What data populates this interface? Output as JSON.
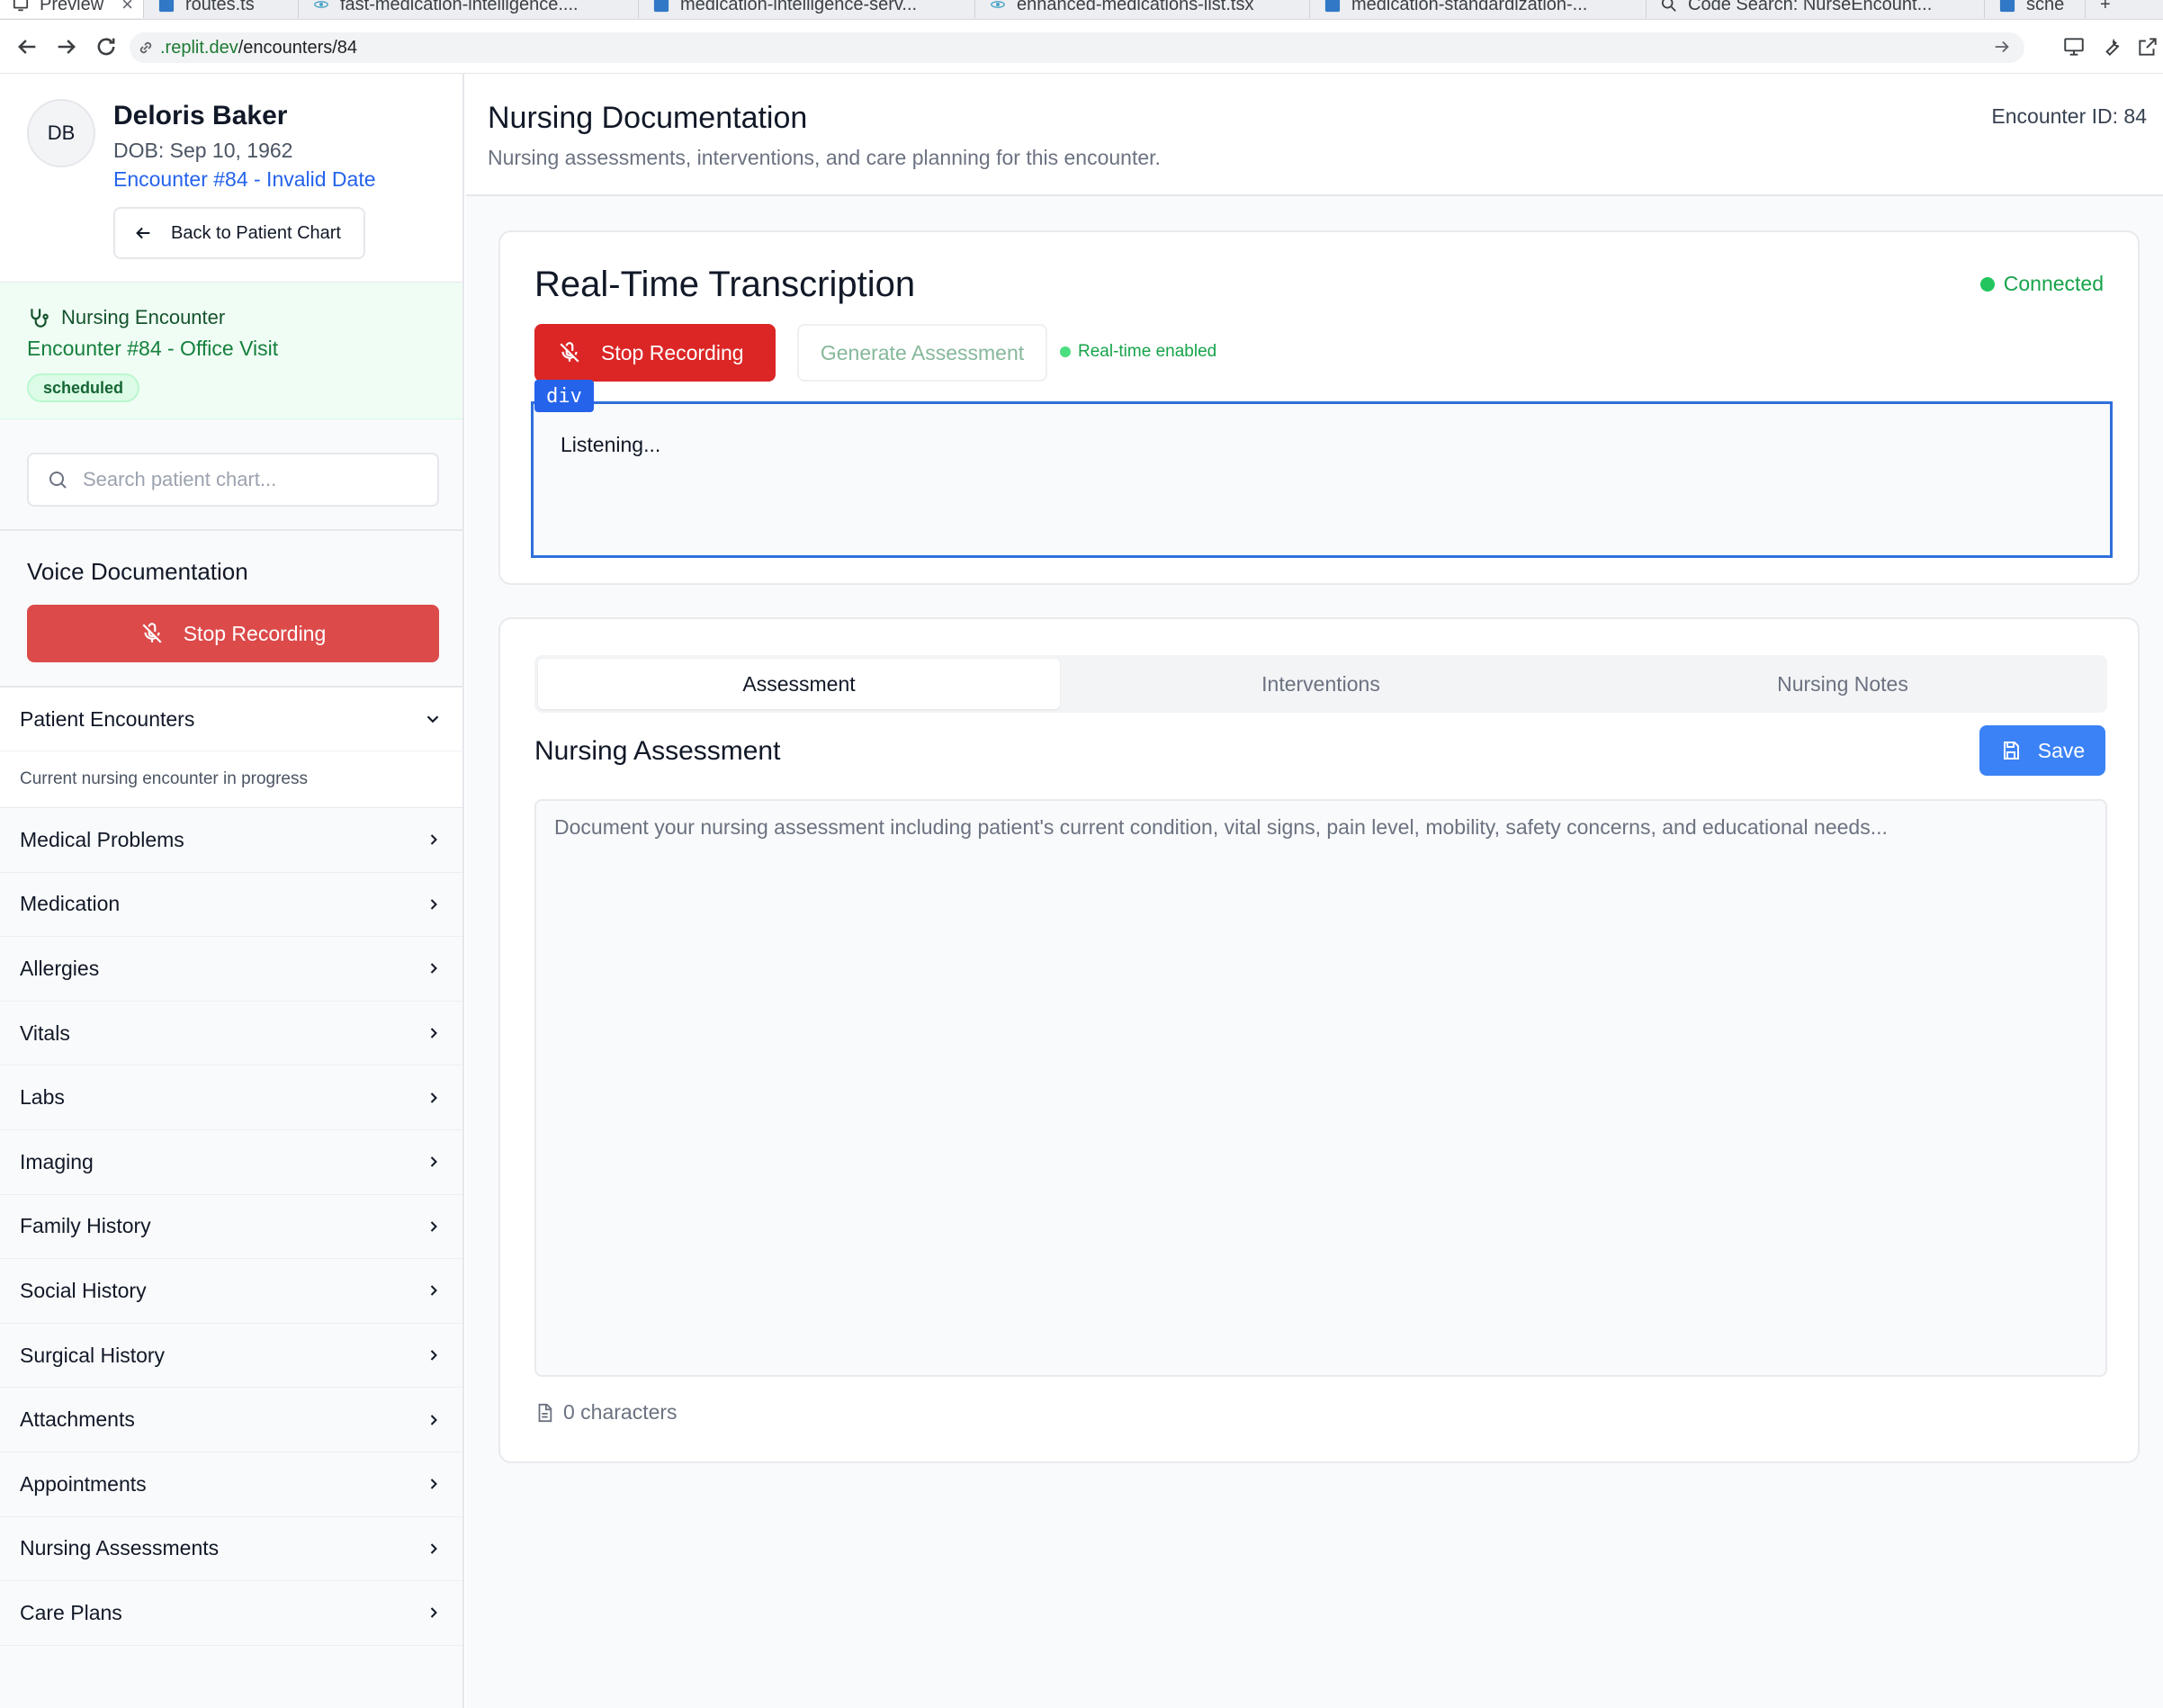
{
  "browser": {
    "tabs": [
      {
        "label": "Preview",
        "icon": "monitor-icon"
      },
      {
        "label": "routes.ts",
        "icon": "ts-file-icon"
      },
      {
        "label": "fast-medication-intelligence....",
        "icon": "react-file-icon"
      },
      {
        "label": "medication-intelligence-serv...",
        "icon": "ts-file-icon"
      },
      {
        "label": "enhanced-medications-list.tsx",
        "icon": "react-file-icon"
      },
      {
        "label": "medication-standardization-...",
        "icon": "ts-file-icon"
      },
      {
        "label": "Code Search: NurseEncount...",
        "icon": "search-icon"
      },
      {
        "label": "sche",
        "icon": "ts-file-icon"
      }
    ],
    "new_tab": "+",
    "url_host": ".replit.dev",
    "url_path": "/encounters/84"
  },
  "patient": {
    "initials": "DB",
    "name": "Deloris Baker",
    "dob": "DOB: Sep 10, 1962",
    "encounter": "Encounter #84 - Invalid Date",
    "back_label": "Back to Patient Chart"
  },
  "encounter_box": {
    "title": "Nursing Encounter",
    "subtitle": "Encounter #84 - Office Visit",
    "status": "scheduled"
  },
  "search": {
    "placeholder": "Search patient chart..."
  },
  "voice": {
    "title": "Voice Documentation",
    "stop_label": "Stop Recording"
  },
  "patient_encounters": {
    "title": "Patient Encounters",
    "subtitle": "Current nursing encounter in progress"
  },
  "nav_items": [
    "Medical Problems",
    "Medication",
    "Allergies",
    "Vitals",
    "Labs",
    "Imaging",
    "Family History",
    "Social History",
    "Surgical History",
    "Attachments",
    "Appointments",
    "Nursing Assessments",
    "Care Plans"
  ],
  "main": {
    "title": "Nursing Documentation",
    "subtitle": "Nursing assessments, interventions, and care planning for this encounter.",
    "encounter_id": "Encounter ID: 84"
  },
  "transcription": {
    "title": "Real-Time Transcription",
    "status": "Connected",
    "stop_label": "Stop Recording",
    "generate_label": "Generate Assessment",
    "realtime_label": "Real-time enabled",
    "inspector_label": "div",
    "text": "Listening..."
  },
  "assessment": {
    "tabs": [
      "Assessment",
      "Interventions",
      "Nursing Notes"
    ],
    "active_tab": 0,
    "title": "Nursing Assessment",
    "save_label": "Save",
    "placeholder": "Document your nursing assessment including patient's current condition, vital signs, pain level, mobility, safety concerns, and educational needs...",
    "char_count": "0 characters"
  },
  "colors": {
    "danger": "#dc2626",
    "primary": "#3b82f6",
    "success": "#16a34a",
    "link": "#2563eb"
  }
}
